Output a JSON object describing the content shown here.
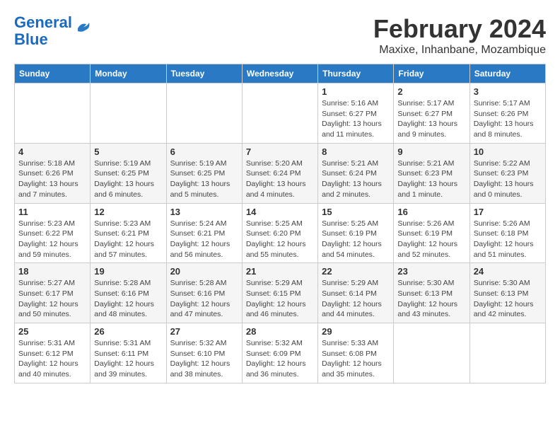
{
  "header": {
    "logo_line1": "General",
    "logo_line2": "Blue",
    "month_title": "February 2024",
    "location": "Maxixe, Inhanbane, Mozambique"
  },
  "weekdays": [
    "Sunday",
    "Monday",
    "Tuesday",
    "Wednesday",
    "Thursday",
    "Friday",
    "Saturday"
  ],
  "weeks": [
    [
      {
        "day": "",
        "info": ""
      },
      {
        "day": "",
        "info": ""
      },
      {
        "day": "",
        "info": ""
      },
      {
        "day": "",
        "info": ""
      },
      {
        "day": "1",
        "info": "Sunrise: 5:16 AM\nSunset: 6:27 PM\nDaylight: 13 hours\nand 11 minutes."
      },
      {
        "day": "2",
        "info": "Sunrise: 5:17 AM\nSunset: 6:27 PM\nDaylight: 13 hours\nand 9 minutes."
      },
      {
        "day": "3",
        "info": "Sunrise: 5:17 AM\nSunset: 6:26 PM\nDaylight: 13 hours\nand 8 minutes."
      }
    ],
    [
      {
        "day": "4",
        "info": "Sunrise: 5:18 AM\nSunset: 6:26 PM\nDaylight: 13 hours\nand 7 minutes."
      },
      {
        "day": "5",
        "info": "Sunrise: 5:19 AM\nSunset: 6:25 PM\nDaylight: 13 hours\nand 6 minutes."
      },
      {
        "day": "6",
        "info": "Sunrise: 5:19 AM\nSunset: 6:25 PM\nDaylight: 13 hours\nand 5 minutes."
      },
      {
        "day": "7",
        "info": "Sunrise: 5:20 AM\nSunset: 6:24 PM\nDaylight: 13 hours\nand 4 minutes."
      },
      {
        "day": "8",
        "info": "Sunrise: 5:21 AM\nSunset: 6:24 PM\nDaylight: 13 hours\nand 2 minutes."
      },
      {
        "day": "9",
        "info": "Sunrise: 5:21 AM\nSunset: 6:23 PM\nDaylight: 13 hours\nand 1 minute."
      },
      {
        "day": "10",
        "info": "Sunrise: 5:22 AM\nSunset: 6:23 PM\nDaylight: 13 hours\nand 0 minutes."
      }
    ],
    [
      {
        "day": "11",
        "info": "Sunrise: 5:23 AM\nSunset: 6:22 PM\nDaylight: 12 hours\nand 59 minutes."
      },
      {
        "day": "12",
        "info": "Sunrise: 5:23 AM\nSunset: 6:21 PM\nDaylight: 12 hours\nand 57 minutes."
      },
      {
        "day": "13",
        "info": "Sunrise: 5:24 AM\nSunset: 6:21 PM\nDaylight: 12 hours\nand 56 minutes."
      },
      {
        "day": "14",
        "info": "Sunrise: 5:25 AM\nSunset: 6:20 PM\nDaylight: 12 hours\nand 55 minutes."
      },
      {
        "day": "15",
        "info": "Sunrise: 5:25 AM\nSunset: 6:19 PM\nDaylight: 12 hours\nand 54 minutes."
      },
      {
        "day": "16",
        "info": "Sunrise: 5:26 AM\nSunset: 6:19 PM\nDaylight: 12 hours\nand 52 minutes."
      },
      {
        "day": "17",
        "info": "Sunrise: 5:26 AM\nSunset: 6:18 PM\nDaylight: 12 hours\nand 51 minutes."
      }
    ],
    [
      {
        "day": "18",
        "info": "Sunrise: 5:27 AM\nSunset: 6:17 PM\nDaylight: 12 hours\nand 50 minutes."
      },
      {
        "day": "19",
        "info": "Sunrise: 5:28 AM\nSunset: 6:16 PM\nDaylight: 12 hours\nand 48 minutes."
      },
      {
        "day": "20",
        "info": "Sunrise: 5:28 AM\nSunset: 6:16 PM\nDaylight: 12 hours\nand 47 minutes."
      },
      {
        "day": "21",
        "info": "Sunrise: 5:29 AM\nSunset: 6:15 PM\nDaylight: 12 hours\nand 46 minutes."
      },
      {
        "day": "22",
        "info": "Sunrise: 5:29 AM\nSunset: 6:14 PM\nDaylight: 12 hours\nand 44 minutes."
      },
      {
        "day": "23",
        "info": "Sunrise: 5:30 AM\nSunset: 6:13 PM\nDaylight: 12 hours\nand 43 minutes."
      },
      {
        "day": "24",
        "info": "Sunrise: 5:30 AM\nSunset: 6:13 PM\nDaylight: 12 hours\nand 42 minutes."
      }
    ],
    [
      {
        "day": "25",
        "info": "Sunrise: 5:31 AM\nSunset: 6:12 PM\nDaylight: 12 hours\nand 40 minutes."
      },
      {
        "day": "26",
        "info": "Sunrise: 5:31 AM\nSunset: 6:11 PM\nDaylight: 12 hours\nand 39 minutes."
      },
      {
        "day": "27",
        "info": "Sunrise: 5:32 AM\nSunset: 6:10 PM\nDaylight: 12 hours\nand 38 minutes."
      },
      {
        "day": "28",
        "info": "Sunrise: 5:32 AM\nSunset: 6:09 PM\nDaylight: 12 hours\nand 36 minutes."
      },
      {
        "day": "29",
        "info": "Sunrise: 5:33 AM\nSunset: 6:08 PM\nDaylight: 12 hours\nand 35 minutes."
      },
      {
        "day": "",
        "info": ""
      },
      {
        "day": "",
        "info": ""
      }
    ]
  ]
}
